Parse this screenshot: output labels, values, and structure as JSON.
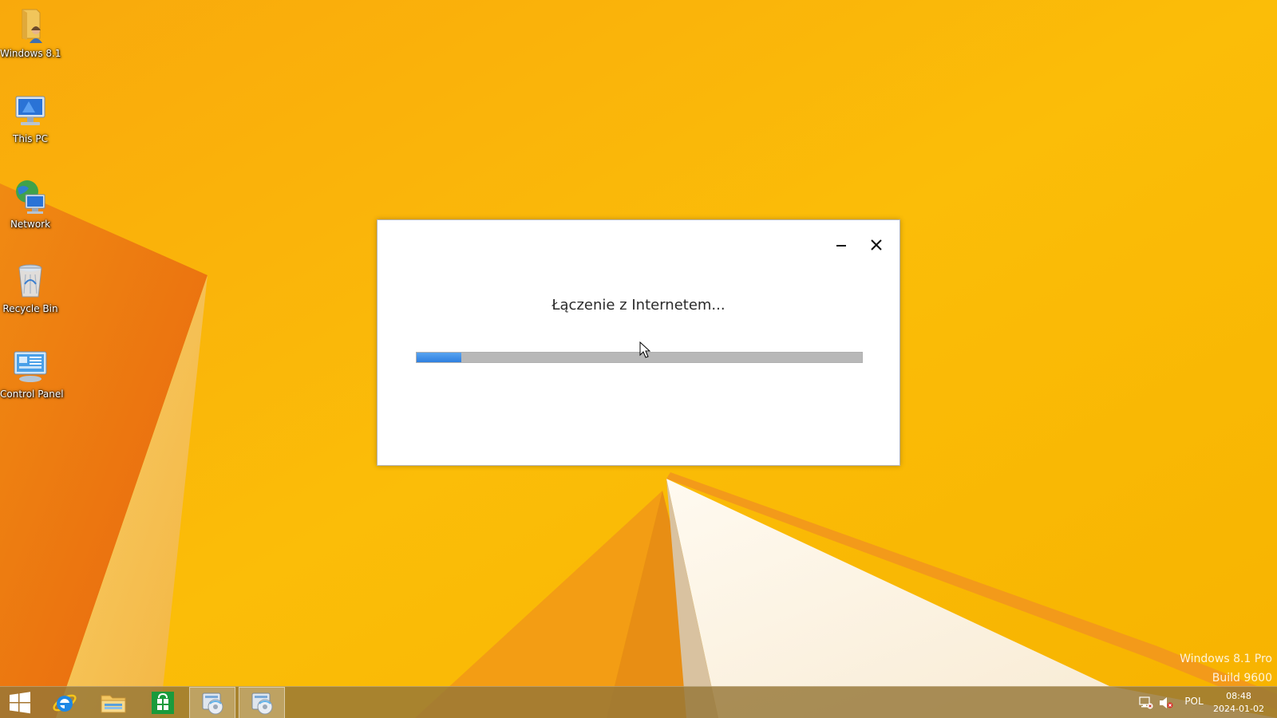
{
  "desktop": {
    "icons": [
      {
        "label": "Windows 8.1",
        "icon": "user-folder-icon"
      },
      {
        "label": "This PC",
        "icon": "computer-icon"
      },
      {
        "label": "Network",
        "icon": "network-icon"
      },
      {
        "label": "Recycle Bin",
        "icon": "recycle-bin-icon"
      },
      {
        "label": "Control Panel",
        "icon": "control-panel-icon"
      }
    ],
    "watermark": {
      "line1": "Windows 8.1 Pro",
      "line2": "Build 9600"
    }
  },
  "dialog": {
    "message": "Łączenie z Internetem...",
    "progress": 0.1,
    "progress_color": "#3b8ae6",
    "buttons": {
      "minimize_icon": "minimize-icon",
      "close_icon": "close-icon"
    }
  },
  "taskbar": {
    "buttons": [
      {
        "icon": "windows-start-icon"
      },
      {
        "icon": "internet-explorer-icon"
      },
      {
        "icon": "file-explorer-icon"
      },
      {
        "icon": "store-icon"
      },
      {
        "icon": "setup-icon"
      },
      {
        "icon": "setup-icon",
        "active": true
      }
    ],
    "tray": {
      "network_icon": "network-tray-icon",
      "volume_icon": "volume-muted-icon",
      "language": "POL",
      "time": "08:48",
      "date": "2024-01-02"
    }
  },
  "colors": {
    "wallpaper_yellow": "#f7b300",
    "wallpaper_orange": "#ef7a10",
    "taskbar": "#96763a"
  }
}
